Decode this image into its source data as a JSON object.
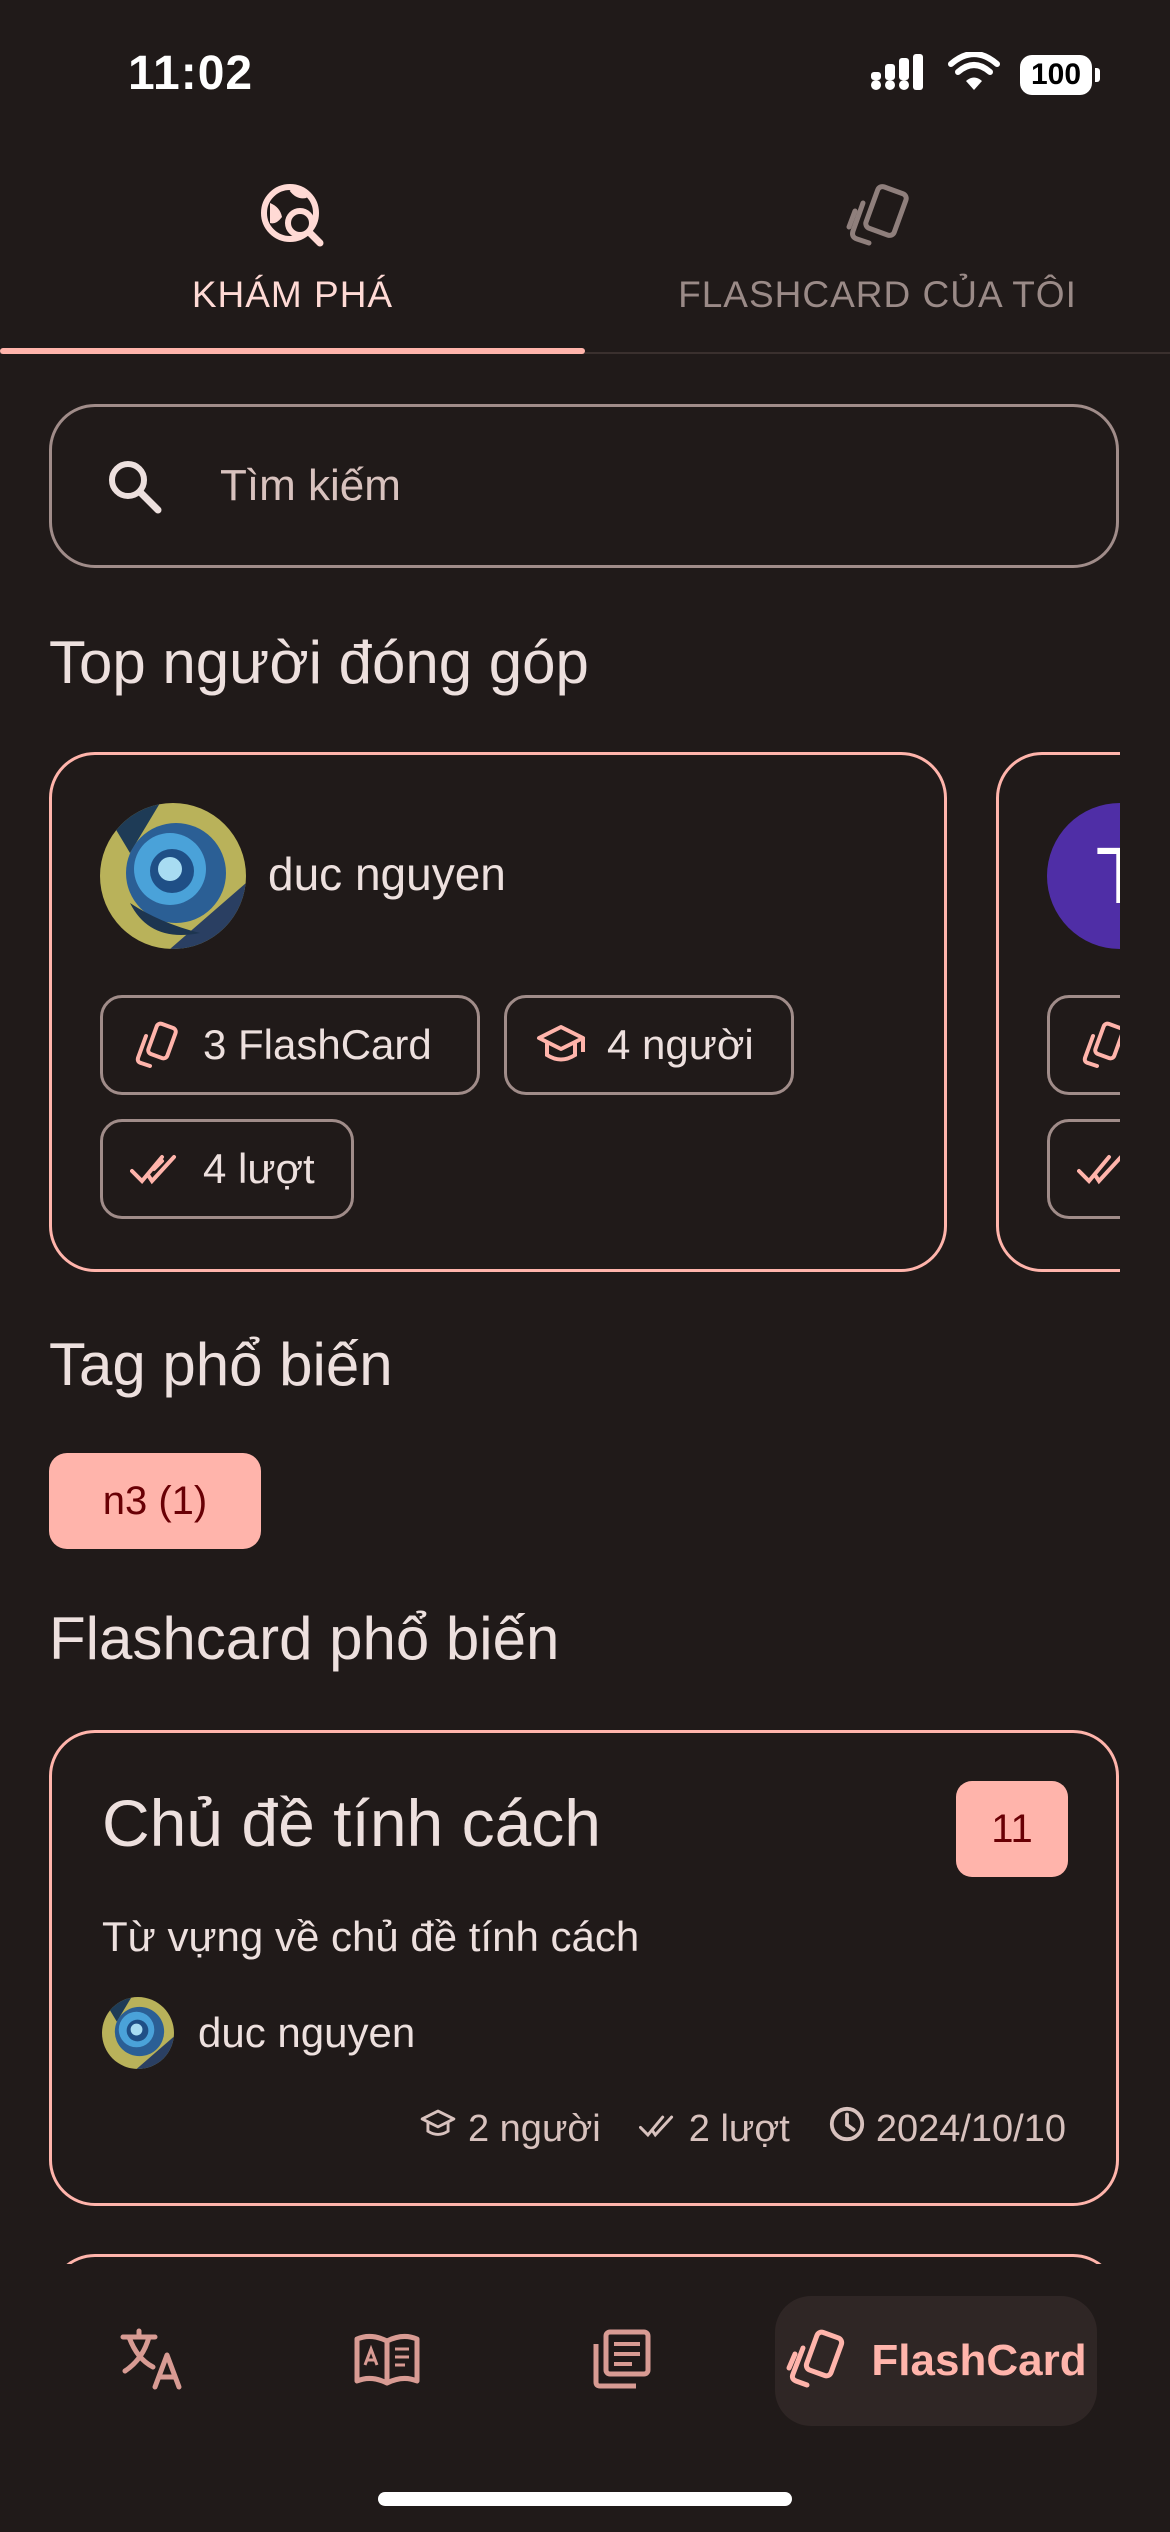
{
  "status_bar": {
    "time": "11:02",
    "battery": "100"
  },
  "tabs": [
    {
      "label": "KHÁM PHÁ",
      "icon": "globe-search-icon",
      "active": true
    },
    {
      "label": "FLASHCARD CỦA TÔI",
      "icon": "flashcard-icon",
      "active": false
    }
  ],
  "search": {
    "placeholder": "Tìm kiếm"
  },
  "sections": {
    "top_contributors": "Top người đóng góp",
    "popular_tags": "Tag phổ biến",
    "popular_flashcards": "Flashcard phổ biến"
  },
  "contributors": [
    {
      "name": "duc nguyen",
      "flashcards": "3 FlashCard",
      "learners": "4 người",
      "plays": "4 lượt"
    },
    {
      "initial": "T"
    }
  ],
  "tags": [
    {
      "label": "n3 (1)"
    }
  ],
  "flashcards": [
    {
      "title": "Chủ đề tính cách",
      "count": "11",
      "description": "Từ vựng về chủ đề tính cách",
      "author": "duc nguyen",
      "learners": "2 người",
      "plays": "2 lượt",
      "date": "2024/10/10"
    }
  ],
  "bottom_nav": {
    "items": [
      {
        "icon": "translate-icon"
      },
      {
        "icon": "dictionary-icon"
      },
      {
        "icon": "article-icon"
      },
      {
        "icon": "flashcard-icon",
        "label": "FlashCard",
        "active": true
      }
    ]
  },
  "colors": {
    "background": "#201a19",
    "accent": "#ffb4ab",
    "on_accent": "#690005",
    "text": "#ede0de",
    "outline": "#a08c89"
  }
}
